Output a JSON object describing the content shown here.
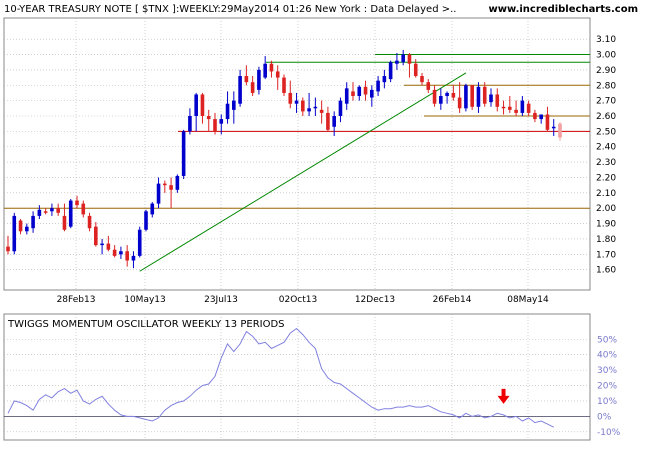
{
  "header": {
    "title": "10-YEAR TREASURY NOTE [ $TNX ]:WEEKLY:29May2014 01:26 New York : Data Delayed >..",
    "site": "www.incrediblecharts.com"
  },
  "oscillator_title": "TWIGGS MOMENTUM OSCILLATOR WEEKLY 13 PERIODS",
  "colors": {
    "up": "#0000cc",
    "down": "#dd2222",
    "pending": "#f4a0a0",
    "grid": "#b5b5b5",
    "oscillator": "#8080e0",
    "trendline": "#008800",
    "support_red": "#cc0000",
    "level_brown": "#996600",
    "arrow": "#ee0000"
  },
  "chart_data": [
    {
      "type": "candlestick",
      "title": "10-YEAR TREASURY NOTE [ $TNX ]:WEEKLY:29May2014 01:26 New York : Data Delayed >..",
      "x_tick_labels": [
        "28Feb13",
        "10May13",
        "23Jul13",
        "02Oct13",
        "12Dec13",
        "26Feb14",
        "08May14"
      ],
      "y_ticks": [
        1.6,
        1.7,
        1.8,
        1.9,
        2.0,
        2.1,
        2.2,
        2.3,
        2.4,
        2.5,
        2.6,
        2.7,
        2.8,
        2.9,
        3.0,
        3.1
      ],
      "y_tick_labels": [
        "1.60",
        "1.70",
        "1.80",
        "1.90",
        "2.00",
        "2.10",
        "2.20",
        "2.30",
        "2.40",
        "2.50",
        "2.60",
        "2.70",
        "2.80",
        "2.90",
        "3.00",
        "3.10"
      ],
      "ylim": [
        1.52,
        3.14
      ],
      "grid": true,
      "ohlc": [
        [
          1.75,
          1.82,
          1.7,
          1.72
        ],
        [
          1.72,
          1.97,
          1.7,
          1.95
        ],
        [
          1.92,
          1.93,
          1.83,
          1.85
        ],
        [
          1.85,
          1.9,
          1.83,
          1.88
        ],
        [
          1.87,
          1.98,
          1.84,
          1.95
        ],
        [
          1.95,
          2.02,
          1.93,
          1.99
        ],
        [
          1.98,
          2.0,
          1.96,
          1.97
        ],
        [
          1.98,
          2.03,
          1.95,
          2.0
        ],
        [
          2.0,
          2.03,
          1.95,
          1.97
        ],
        [
          1.95,
          2.03,
          1.85,
          1.86
        ],
        [
          1.88,
          2.06,
          1.87,
          2.05
        ],
        [
          2.05,
          2.08,
          2.0,
          2.02
        ],
        [
          2.03,
          2.05,
          1.94,
          1.96
        ],
        [
          1.95,
          1.97,
          1.85,
          1.87
        ],
        [
          1.88,
          1.91,
          1.75,
          1.76
        ],
        [
          1.76,
          1.8,
          1.7,
          1.77
        ],
        [
          1.77,
          1.82,
          1.72,
          1.73
        ],
        [
          1.73,
          1.76,
          1.68,
          1.69
        ],
        [
          1.7,
          1.75,
          1.67,
          1.72
        ],
        [
          1.72,
          1.76,
          1.62,
          1.66
        ],
        [
          1.66,
          1.72,
          1.61,
          1.69
        ],
        [
          1.69,
          1.88,
          1.68,
          1.86
        ],
        [
          1.86,
          1.99,
          1.85,
          1.98
        ],
        [
          1.96,
          2.04,
          1.94,
          2.03
        ],
        [
          2.03,
          2.2,
          2.0,
          2.16
        ],
        [
          2.16,
          2.18,
          2.1,
          2.15
        ],
        [
          2.15,
          2.2,
          2.0,
          2.12
        ],
        [
          2.12,
          2.22,
          2.1,
          2.21
        ],
        [
          2.21,
          2.51,
          2.19,
          2.5
        ],
        [
          2.5,
          2.65,
          2.48,
          2.6
        ],
        [
          2.6,
          2.75,
          2.5,
          2.74
        ],
        [
          2.74,
          2.75,
          2.55,
          2.6
        ],
        [
          2.6,
          2.64,
          2.5,
          2.58
        ],
        [
          2.58,
          2.62,
          2.48,
          2.5
        ],
        [
          2.55,
          2.61,
          2.48,
          2.58
        ],
        [
          2.58,
          2.76,
          2.55,
          2.68
        ],
        [
          2.64,
          2.76,
          2.55,
          2.7
        ],
        [
          2.68,
          2.9,
          2.66,
          2.86
        ],
        [
          2.86,
          2.93,
          2.8,
          2.82
        ],
        [
          2.82,
          2.86,
          2.73,
          2.75
        ],
        [
          2.77,
          2.92,
          2.74,
          2.9
        ],
        [
          2.85,
          2.99,
          2.84,
          2.94
        ],
        [
          2.94,
          2.96,
          2.85,
          2.89
        ],
        [
          2.89,
          2.93,
          2.77,
          2.85
        ],
        [
          2.85,
          2.87,
          2.73,
          2.75
        ],
        [
          2.75,
          2.83,
          2.65,
          2.68
        ],
        [
          2.68,
          2.75,
          2.62,
          2.7
        ],
        [
          2.7,
          2.72,
          2.6,
          2.63
        ],
        [
          2.63,
          2.75,
          2.6,
          2.65
        ],
        [
          2.65,
          2.72,
          2.6,
          2.66
        ],
        [
          2.64,
          2.7,
          2.55,
          2.62
        ],
        [
          2.62,
          2.66,
          2.5,
          2.51
        ],
        [
          2.53,
          2.63,
          2.47,
          2.6
        ],
        [
          2.6,
          2.72,
          2.56,
          2.7
        ],
        [
          2.68,
          2.82,
          2.64,
          2.78
        ],
        [
          2.76,
          2.82,
          2.7,
          2.73
        ],
        [
          2.73,
          2.8,
          2.7,
          2.79
        ],
        [
          2.79,
          2.83,
          2.7,
          2.74
        ],
        [
          2.72,
          2.8,
          2.66,
          2.77
        ],
        [
          2.76,
          2.86,
          2.73,
          2.83
        ],
        [
          2.82,
          2.9,
          2.78,
          2.86
        ],
        [
          2.84,
          2.96,
          2.82,
          2.95
        ],
        [
          2.94,
          3.01,
          2.9,
          2.96
        ],
        [
          2.95,
          3.03,
          2.93,
          3.0
        ],
        [
          3.0,
          3.01,
          2.85,
          2.94
        ],
        [
          2.94,
          2.97,
          2.85,
          2.86
        ],
        [
          2.86,
          2.88,
          2.8,
          2.82
        ],
        [
          2.82,
          2.84,
          2.75,
          2.77
        ],
        [
          2.77,
          2.8,
          2.66,
          2.68
        ],
        [
          2.68,
          2.78,
          2.64,
          2.73
        ],
        [
          2.73,
          2.76,
          2.68,
          2.75
        ],
        [
          2.75,
          2.8,
          2.7,
          2.72
        ],
        [
          2.72,
          2.82,
          2.62,
          2.65
        ],
        [
          2.65,
          2.81,
          2.63,
          2.8
        ],
        [
          2.8,
          2.8,
          2.64,
          2.66
        ],
        [
          2.66,
          2.82,
          2.62,
          2.79
        ],
        [
          2.79,
          2.82,
          2.66,
          2.68
        ],
        [
          2.69,
          2.78,
          2.66,
          2.74
        ],
        [
          2.74,
          2.78,
          2.63,
          2.66
        ],
        [
          2.66,
          2.7,
          2.61,
          2.65
        ],
        [
          2.66,
          2.73,
          2.62,
          2.64
        ],
        [
          2.64,
          2.7,
          2.6,
          2.62
        ],
        [
          2.62,
          2.73,
          2.6,
          2.7
        ],
        [
          2.68,
          2.7,
          2.6,
          2.62
        ],
        [
          2.62,
          2.64,
          2.56,
          2.58
        ],
        [
          2.58,
          2.61,
          2.55,
          2.61
        ],
        [
          2.61,
          2.66,
          2.5,
          2.51
        ],
        [
          2.52,
          2.58,
          2.47,
          2.53
        ]
      ],
      "pending_candle": [
        2.55,
        2.56,
        2.44,
        2.46
      ],
      "annotations": {
        "horizontal_lines": [
          {
            "y": 3.0,
            "color": "trendline"
          },
          {
            "y": 2.95,
            "color": "trendline"
          },
          {
            "y": 2.8,
            "color": "level_brown"
          },
          {
            "y": 2.6,
            "color": "level_brown"
          },
          {
            "y": 2.5,
            "color": "support_red"
          },
          {
            "y": 2.0,
            "color": "level_brown"
          }
        ],
        "trendline": {
          "from_bar": 21,
          "from_y": 1.59,
          "to_bar": 73,
          "to_y": 2.88
        }
      }
    },
    {
      "type": "line",
      "title": "TWIGGS MOMENTUM OSCILLATOR WEEKLY 13 PERIODS",
      "y_ticks": [
        50,
        40,
        30,
        20,
        10,
        0,
        -10
      ],
      "y_tick_labels": [
        "50%",
        "40%",
        "30%",
        "20%",
        "10%",
        "0%",
        "-10%"
      ],
      "ylim": [
        -14,
        56
      ],
      "zero_line": true,
      "grid": true,
      "values": [
        2,
        10,
        9,
        7,
        4,
        11,
        14,
        12,
        16,
        18,
        15,
        17,
        10,
        8,
        11,
        13,
        8,
        4,
        1,
        0,
        0,
        -1,
        -2,
        -3,
        -1,
        4,
        7,
        9,
        10,
        13,
        17,
        20,
        21,
        26,
        38,
        47,
        42,
        47,
        55,
        52,
        47,
        48,
        44,
        46,
        48,
        54,
        57,
        53,
        48,
        44,
        31,
        25,
        22,
        21,
        18,
        15,
        12,
        9,
        6,
        4,
        5,
        5,
        6,
        6,
        7,
        6,
        6,
        7,
        5,
        3,
        2,
        1,
        -1,
        2,
        0,
        1,
        -1,
        0,
        2,
        1,
        -1,
        0,
        -3,
        -1,
        -4,
        -3,
        -5,
        -7
      ],
      "signal_arrow": {
        "bar": 79,
        "direction": "down"
      }
    }
  ]
}
